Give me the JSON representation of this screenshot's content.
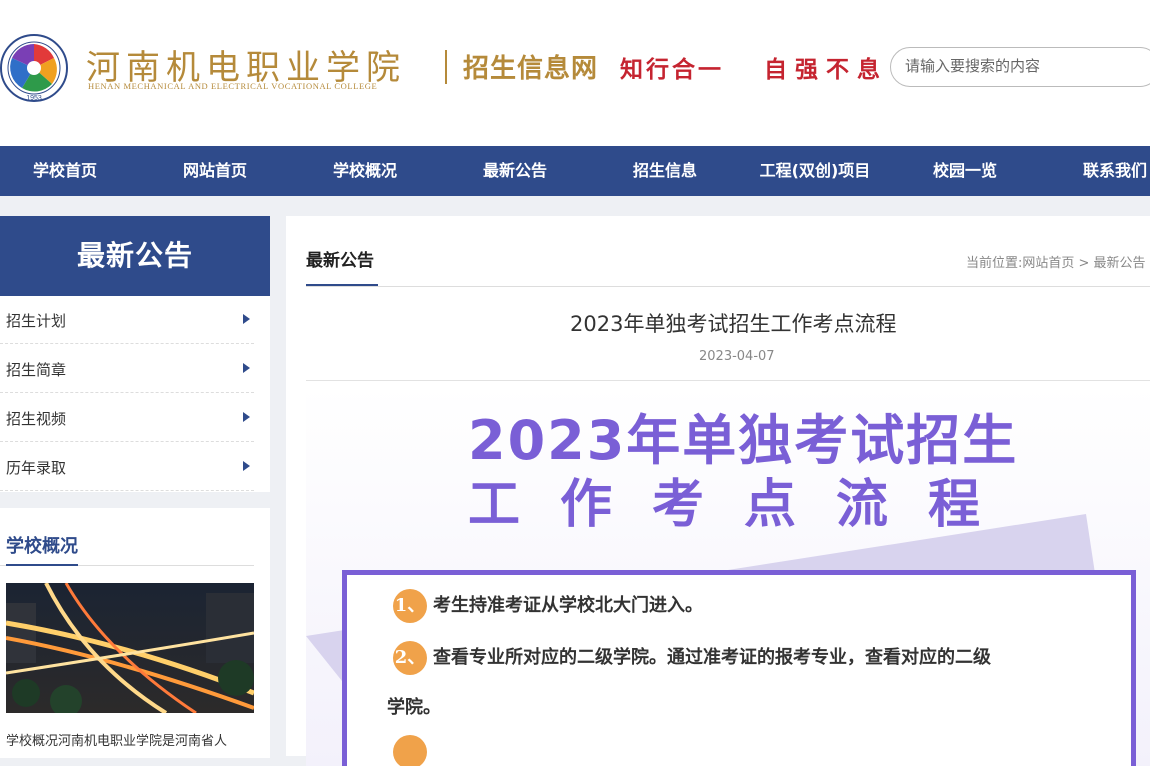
{
  "header": {
    "logo_year": "1953",
    "school_name_cn": "河南机电职业学院",
    "school_name_en": "HENAN MECHANICAL AND ELECTRICAL VOCATIONAL COLLEGE",
    "site_name": "招生信息网",
    "motto_1": "知行合一",
    "motto_2": "自强不息",
    "search_placeholder": "请输入要搜索的内容"
  },
  "nav": {
    "items": [
      {
        "label": "学校首页"
      },
      {
        "label": "网站首页"
      },
      {
        "label": "学校概况"
      },
      {
        "label": "最新公告"
      },
      {
        "label": "招生信息"
      },
      {
        "label": "工程(双创)项目"
      },
      {
        "label": "校园一览"
      },
      {
        "label": "联系我们"
      }
    ]
  },
  "sidebar": {
    "header": "最新公告",
    "items": [
      {
        "label": "招生计划"
      },
      {
        "label": "招生简章"
      },
      {
        "label": "招生视频"
      },
      {
        "label": "历年录取"
      }
    ],
    "overview_title": "学校概况",
    "overview_text": "学校概况河南机电职业学院是河南省人"
  },
  "main": {
    "section_title": "最新公告",
    "breadcrumb": "当前位置:网站首页 > 最新公告",
    "article_title": "2023年单独考试招生工作考点流程",
    "article_date": "2023-04-07",
    "poster": {
      "heading_1": "2023年单独考试招生",
      "heading_2": "工作考点流程",
      "steps": [
        {
          "num": "1、",
          "text": "考生持准考证从学校北大门进入。"
        },
        {
          "num": "2、",
          "text": "查看专业所对应的二级学院。通过准考证的报考专业，查看对应的二级"
        },
        {
          "num": "",
          "text": "学院。"
        }
      ]
    }
  },
  "colors": {
    "nav_blue": "#2f4b8b",
    "gold": "#b58a3a",
    "motto_red": "#c52430",
    "poster_purple": "#7a5fd6",
    "badge_orange": "#f0a24a"
  }
}
